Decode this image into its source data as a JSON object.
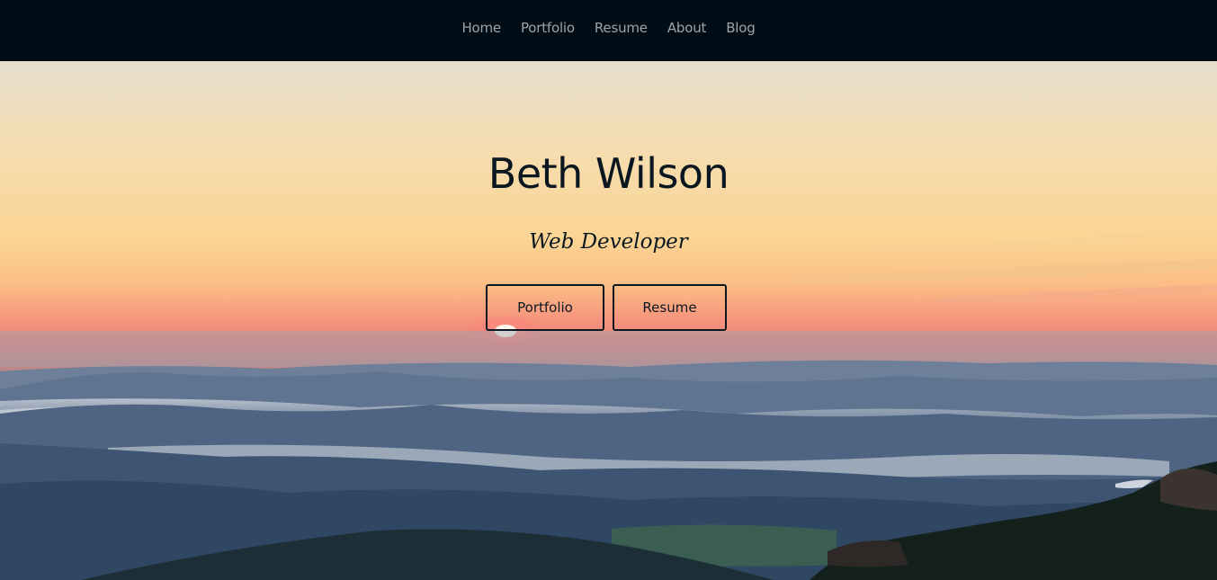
{
  "nav": {
    "items": [
      {
        "label": "Home"
      },
      {
        "label": "Portfolio"
      },
      {
        "label": "Resume"
      },
      {
        "label": "About"
      },
      {
        "label": "Blog"
      }
    ]
  },
  "hero": {
    "title": "Beth Wilson",
    "subtitle": "Web Developer",
    "buttons": {
      "portfolio_label": "Portfolio",
      "resume_label": "Resume"
    }
  },
  "colors": {
    "nav_background": "#010d16",
    "nav_text": "#9ea4a8",
    "hero_text": "#0b1720"
  }
}
